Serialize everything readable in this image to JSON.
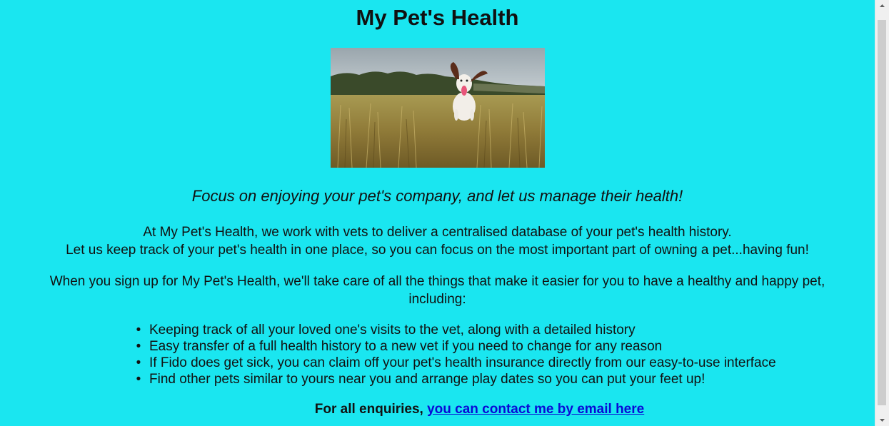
{
  "page": {
    "title": "My Pet's Health",
    "hero_alt": "Dog running through a wheat field",
    "tagline": "Focus on enjoying your pet's company, and let us manage their health!",
    "intro_line1": "At My Pet's Health, we work with vets to deliver a centralised database of your pet's health history.",
    "intro_line2": "Let us keep track of your pet's health in one place, so you can focus on the most important part of owning a pet...having fun!",
    "signup_text": "When you sign up for My Pet's Health, we'll take care of all the things that make it easier for you to have a healthy and happy pet, including:",
    "features": [
      "Keeping track of all your loved one's visits to the vet, along with a detailed history",
      "Easy transfer of a full health history to a new vet if you need to change for any reason",
      "If Fido does get sick, you can claim off your pet's health insurance directly from our easy-to-use interface",
      "Find other pets similar to yours near you and arrange play dates so you can put your feet up!"
    ],
    "contact_label": "For all enquiries,",
    "contact_link": "you can contact me by email here"
  },
  "colors": {
    "background": "#1ae6f0",
    "link": "#0a0ad6"
  },
  "icons": {
    "scroll_up": "chevron-up-icon",
    "scroll_down": "chevron-down-icon"
  }
}
